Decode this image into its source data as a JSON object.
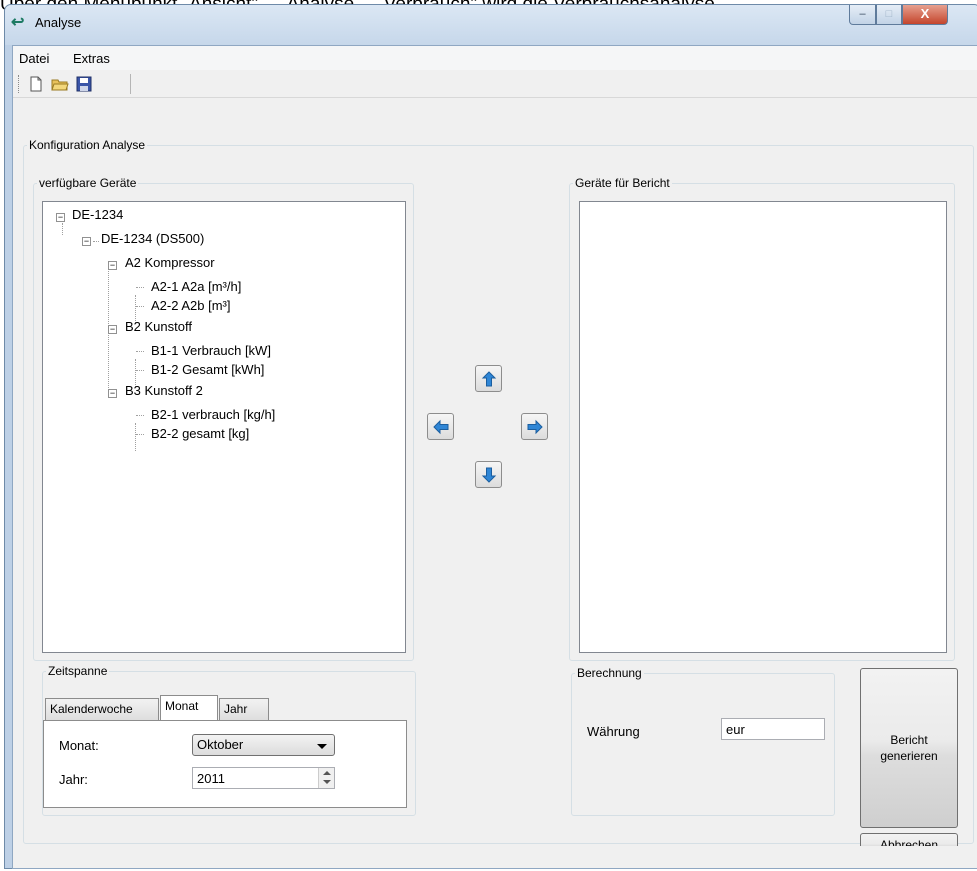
{
  "caption": "Über den Menüpunkt „Ansicht\" → Analyse → Verbrauch\" wird die Verbrauchsanalyse",
  "window": {
    "title": "Analyse"
  },
  "menu": {
    "file": "Datei",
    "extras": "Extras"
  },
  "toolbar_icons": [
    "new-document-icon",
    "open-folder-icon",
    "save-disk-icon"
  ],
  "config_group": {
    "title": "Konfiguration Analyse"
  },
  "available": {
    "title": "verfügbare Geräte",
    "tree": {
      "root": "DE-1234",
      "device": "DE-1234 (DS500)",
      "groups": [
        {
          "label": "A2 Kompressor",
          "items": [
            "A2-1 A2a [m³/h]",
            "A2-2 A2b [m³]"
          ]
        },
        {
          "label": "B2 Kunstoff",
          "items": [
            "B1-1 Verbrauch [kW]",
            "B1-2 Gesamt [kWh]"
          ]
        },
        {
          "label": "B3 Kunstoff 2",
          "items": [
            "B2-1 verbrauch [kg/h]",
            "B2-2 gesamt [kg]"
          ]
        }
      ]
    }
  },
  "report": {
    "title": "Geräte für Bericht"
  },
  "arrows": [
    "arrow-up-icon",
    "arrow-left-icon",
    "arrow-right-icon",
    "arrow-down-icon"
  ],
  "timespan": {
    "title": "Zeitspanne",
    "tabs": [
      "Kalenderwoche",
      "Monat",
      "Jahr"
    ],
    "active_tab": "Monat",
    "month_label": "Monat:",
    "month_value": "Oktober",
    "year_label": "Jahr:",
    "year_value": "2011"
  },
  "calculation": {
    "title": "Berechnung",
    "currency_label": "Währung",
    "currency_value": "eur"
  },
  "buttons": {
    "generate_line1": "Bericht",
    "generate_line2": "generieren",
    "cancel": "Abbrechen"
  },
  "colors": {
    "arrow_blue": "#2f86d6",
    "title_bar": "#c6d7ea",
    "close_button": "#c4452c"
  }
}
